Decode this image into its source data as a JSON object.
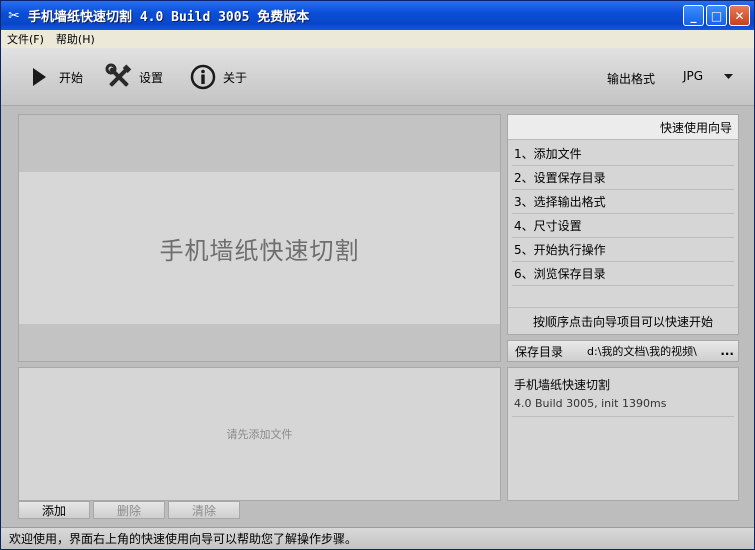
{
  "window": {
    "title": "手机墙纸快速切割 4.0 Build 3005 免费版本",
    "controls": {
      "minimize": "_",
      "maximize": "□",
      "close": "✕"
    }
  },
  "menubar": {
    "items": [
      {
        "label": "文件(F)"
      },
      {
        "label": "帮助(H)"
      }
    ]
  },
  "toolbar": {
    "start_label": "开始",
    "settings_label": "设置",
    "about_label": "关于",
    "format_label": "输出格式",
    "format_value": "JPG",
    "icons": {
      "start": "play-icon",
      "settings": "tools-icon",
      "about": "info-icon"
    }
  },
  "preview": {
    "title": "手机墙纸快速切割"
  },
  "guide": {
    "header": "快速使用向导",
    "items": [
      {
        "label": "1、添加文件"
      },
      {
        "label": "2、设置保存目录"
      },
      {
        "label": "3、选择输出格式"
      },
      {
        "label": "4、尺寸设置"
      },
      {
        "label": "5、开始执行操作"
      },
      {
        "label": "6、浏览保存目录"
      }
    ],
    "footer": "按顺序点击向导项目可以快速开始"
  },
  "save_dir": {
    "label": "保存目录",
    "path": "d:\\我的文档\\我的视频\\",
    "browse": "..."
  },
  "file_list": {
    "empty_hint": "请先添加文件"
  },
  "file_buttons": {
    "add": "添加",
    "remove": "删除",
    "clear": "清除"
  },
  "info": {
    "app_name": "手机墙纸快速切割",
    "version": "4.0 Build 3005, init 1390ms"
  },
  "status": {
    "text": "欢迎使用，界面右上角的快速使用向导可以帮助您了解操作步骤。"
  },
  "colors": {
    "titlebar": "#0a4fd8",
    "panel": "#d6d6d6",
    "background": "#bdbdbd"
  }
}
